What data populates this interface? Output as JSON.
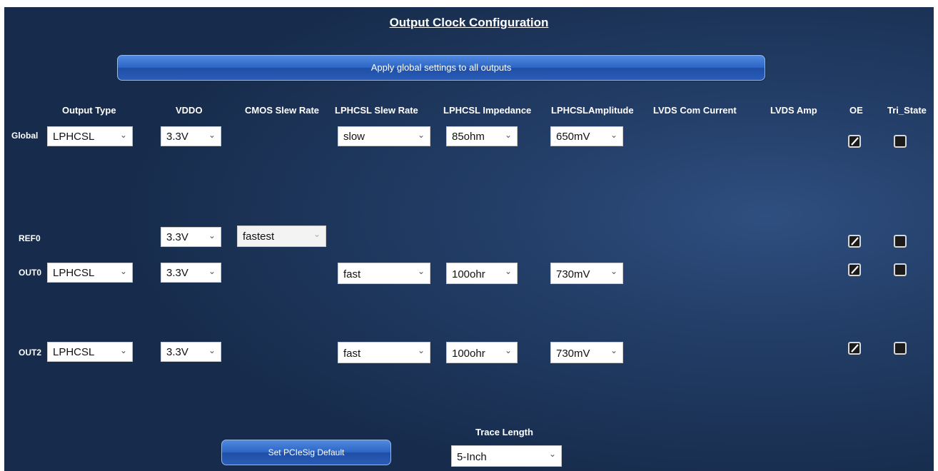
{
  "page": {
    "title": "Output Clock Configuration"
  },
  "buttons": {
    "apply_global": "Apply global settings to all outputs",
    "pcie_default": "Set PCIeSig Default"
  },
  "columns": {
    "output_type": "Output Type",
    "vddo": "VDDO",
    "cmos_slew": "CMOS Slew Rate",
    "lphcsl_slew": "LPHCSL Slew Rate",
    "lphcsl_impedance": "LPHCSL Impedance",
    "lphcsl_amplitude": "LPHCSLAmplitude",
    "lvds_com": "LVDS Com Current",
    "lvds_amp": "LVDS Amp",
    "oe": "OE",
    "tri_state": "Tri_State"
  },
  "rows": {
    "global": {
      "label": "Global",
      "output_type": "LPHCSL",
      "vddo": "3.3V",
      "slew": "slow",
      "impedance": "85ohm",
      "amplitude": "650mV",
      "oe": true,
      "tri_state": false
    },
    "ref0": {
      "label": "REF0",
      "vddo": "3.3V",
      "cmos_slew": "fastest",
      "oe": true,
      "tri_state": false
    },
    "out0": {
      "label": "OUT0",
      "output_type": "LPHCSL",
      "vddo": "3.3V",
      "slew": "fast",
      "impedance": "100ohr",
      "amplitude": "730mV",
      "oe": true,
      "tri_state": false
    },
    "out2": {
      "label": "OUT2",
      "output_type": "LPHCSL",
      "vddo": "3.3V",
      "slew": "fast",
      "impedance": "100ohr",
      "amplitude": "730mV",
      "oe": true,
      "tri_state": false
    }
  },
  "trace": {
    "label": "Trace Length",
    "value": "5-Inch"
  },
  "icons": {
    "dropdown": "chevron-down-icon",
    "checked": "checkmark-icon"
  },
  "colors": {
    "background": "#1f3a63",
    "button": "#2c64c4",
    "text": "#ffffff"
  }
}
